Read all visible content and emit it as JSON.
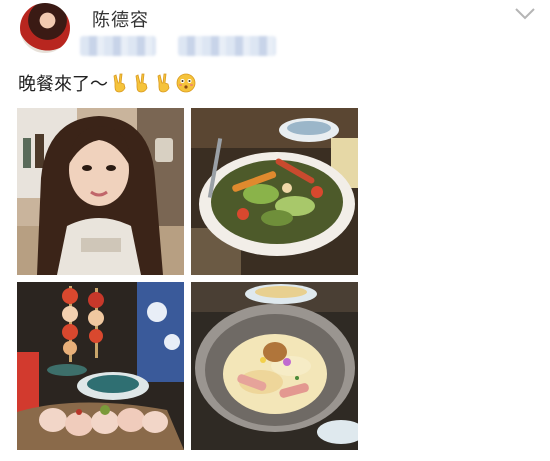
{
  "post": {
    "author": "陈德容",
    "text": "晚餐來了～",
    "emojis": [
      "victory-hand-emoji",
      "victory-hand-emoji",
      "victory-hand-emoji",
      "flushed-face-emoji"
    ]
  },
  "photos": [
    {
      "name": "selfie-photo",
      "subject": "selfie"
    },
    {
      "name": "salad-photo",
      "subject": "salad"
    },
    {
      "name": "skewers-photo",
      "subject": "skewers"
    },
    {
      "name": "risotto-photo",
      "subject": "risotto"
    }
  ],
  "colors": {
    "text": "#222222",
    "name": "#333333",
    "chevron": "#b5b5b5",
    "emoji": "#f5c33b"
  }
}
